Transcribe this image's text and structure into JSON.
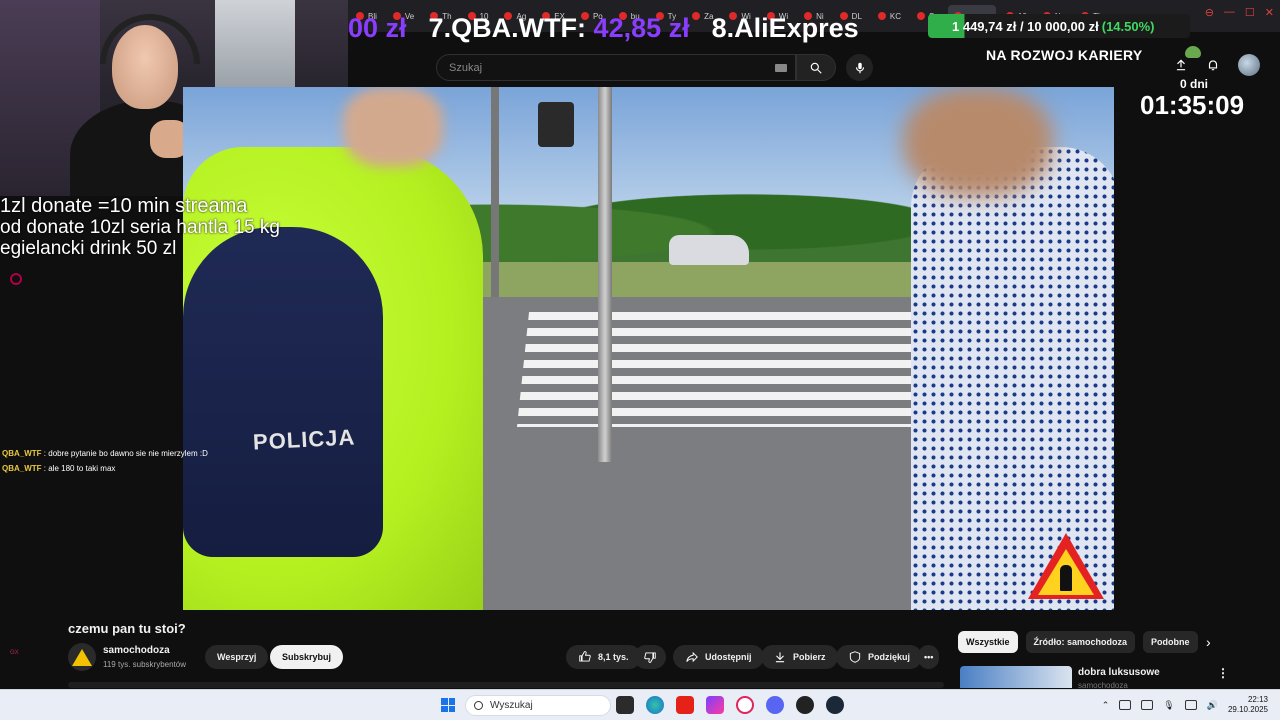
{
  "browser": {
    "tabs": [
      "Bli",
      "Ve",
      "Th",
      "10",
      "Ag",
      "EX",
      "Po",
      "bu",
      "Ty",
      "Za",
      "Wi",
      "Wi",
      "Ni",
      "DL",
      "KC",
      "Sz",
      "czemu",
      "10",
      "Ne",
      "Th"
    ],
    "active_tab": "czemu",
    "new_tab": "+"
  },
  "overlay": {
    "ticker_partial": "00 zł",
    "ticker_item_label": "7.QBA.WTF:",
    "ticker_item_value": "42,85 zł",
    "ticker_next": "8.AliExpres",
    "goal_amount": "1 449,74 zł / 10 000,00 zł",
    "goal_percent": "(14.50%)",
    "career": "NA ROZWOJ KARIERY",
    "days": "0 dni",
    "timer": "01:35:09",
    "donation_lines": [
      "1zl donate =10 min streama",
      "od donate 10zl seria hantla 15 kg",
      "egielancki drink 50 zl"
    ],
    "corner_tag": "GX"
  },
  "chat": [
    {
      "user": "QBA_WTF",
      "message": ": dobre pytanie bo dawno sie nie mierzylem :D"
    },
    {
      "user": "QBA_WTF",
      "message": ": ale 180 to taki max"
    }
  ],
  "youtube": {
    "search_placeholder": "Szukaj",
    "video_badge_text": "POLICJA",
    "video_title": "czemu pan tu stoi?",
    "channel_name": "samochodoza",
    "channel_subs": "119 tys. subskrybentów",
    "support_label": "Wesprzyj",
    "subscribe_label": "Subskrybuj",
    "likes": "8,1 tys.",
    "share_label": "Udostępnij",
    "download_label": "Pobierz",
    "thanks_label": "Podziękuj",
    "more_label": "•••",
    "chips": [
      "Wszystkie",
      "Źródło: samochodoza",
      "Podobne"
    ],
    "rec_title": "dobra luksusowe",
    "rec_channel": "samochodoza"
  },
  "taskbar": {
    "search_placeholder": "Wyszukaj",
    "time": "22:13",
    "date": "29.10.2025"
  },
  "colors": {
    "accent_purple": "#8b3dff",
    "goal_green": "#40d860",
    "yt_bg": "#0f0f0f"
  }
}
